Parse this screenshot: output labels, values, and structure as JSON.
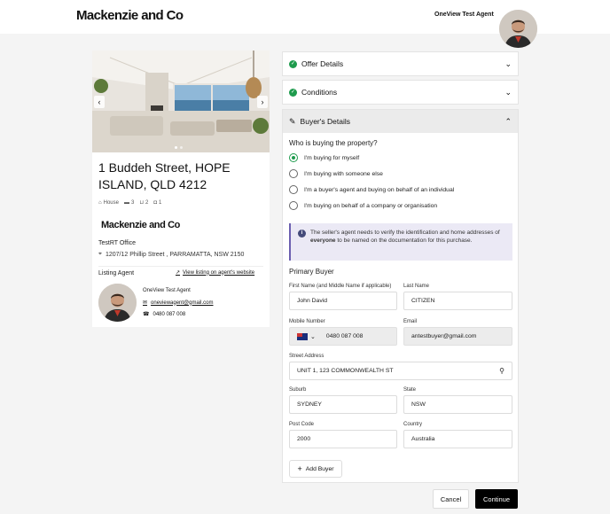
{
  "header": {
    "logo_text": "Mackenzie and Co",
    "agent_name": "OneView Test Agent"
  },
  "property": {
    "address": "1 Buddeh Street, HOPE ISLAND, QLD 4212",
    "type": "House",
    "bedrooms": "3",
    "bathrooms": "2",
    "parking": "1",
    "agency_logo_text": "Mackenzie and Co",
    "office_name": "TestRT Office",
    "office_address": "1207/12 Phillip Street , PARRAMATTA, NSW 2150",
    "listing_agent_label": "Listing Agent",
    "view_listing_label": "View listing on agent's website",
    "agent_name": "OneView Test Agent",
    "agent_email": "oneviewagent@gmail.com",
    "agent_phone": "0480 087 008"
  },
  "accordions": {
    "offer_details": "Offer Details",
    "conditions": "Conditions",
    "buyers_details": "Buyer's Details"
  },
  "buyers": {
    "question": "Who is buying the property?",
    "options": [
      "I'm buying for myself",
      "I'm buying with someone else",
      "I'm a buyer's agent and buying on behalf of an individual",
      "I'm buying on behalf of a company or organisation"
    ],
    "selected_index": 0,
    "info_pre": "The seller's agent needs to verify the identification and home addresses of ",
    "info_bold": "everyone",
    "info_post": " to be named on the documentation for this purchase.",
    "section_title": "Primary Buyer",
    "first_name_label": "First Name (and Middle Name if applicable)",
    "first_name_value": "John David",
    "last_name_label": "Last Name",
    "last_name_value": "CITIZEN",
    "mobile_label": "Mobile Number",
    "mobile_value": "0480 087 008",
    "email_label": "Email",
    "email_value": "antestbuyer@gmail.com",
    "street_label": "Street Address",
    "street_value": "UNIT 1, 123 COMMONWEALTH ST",
    "suburb_label": "Suburb",
    "suburb_value": "SYDNEY",
    "state_label": "State",
    "state_value": "NSW",
    "postcode_label": "Post Code",
    "postcode_value": "2000",
    "country_label": "Country",
    "country_value": "Australia",
    "add_buyer_label": "Add Buyer"
  },
  "footer": {
    "cancel_label": "Cancel",
    "continue_label": "Continue"
  },
  "colors": {
    "accent_green": "#1e9b4d",
    "info_bg": "#ebe9f5",
    "primary_button": "#000000"
  }
}
